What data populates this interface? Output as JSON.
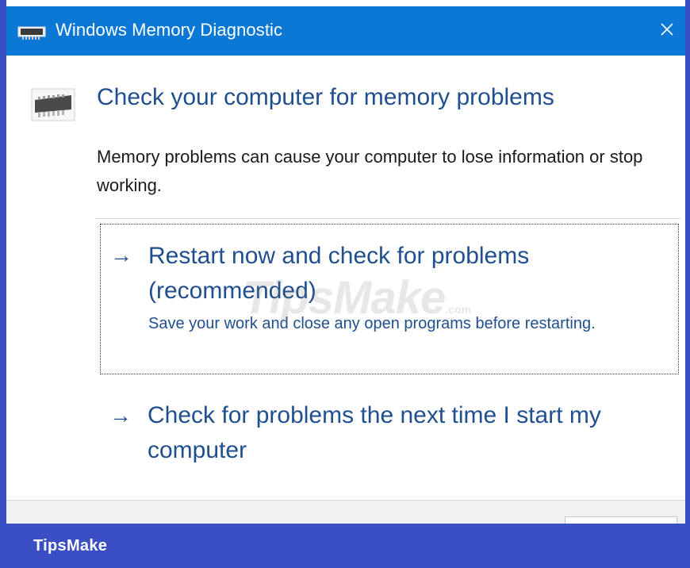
{
  "window": {
    "title": "Windows Memory Diagnostic",
    "app_icon": "memory-chip-icon",
    "close_icon": "close-icon",
    "title_bar_color": "#0a78d4"
  },
  "main": {
    "icon": "memory-chip-icon",
    "heading": "Check your computer for memory problems",
    "description": "Memory problems can cause your computer to lose information or stop working.",
    "options": [
      {
        "arrow": "→",
        "title": "Restart now and check for problems (recommended)",
        "subtitle": "Save your work and close any open programs before restarting."
      },
      {
        "arrow": "→",
        "title": "Check for problems the next time I start my computer"
      }
    ],
    "link_color": "#1f4f8f"
  },
  "watermark": {
    "main": "TipsMake",
    "suffix": ".com"
  },
  "brand": {
    "label": "TipsMake",
    "bar_color": "#3a4fc4"
  }
}
